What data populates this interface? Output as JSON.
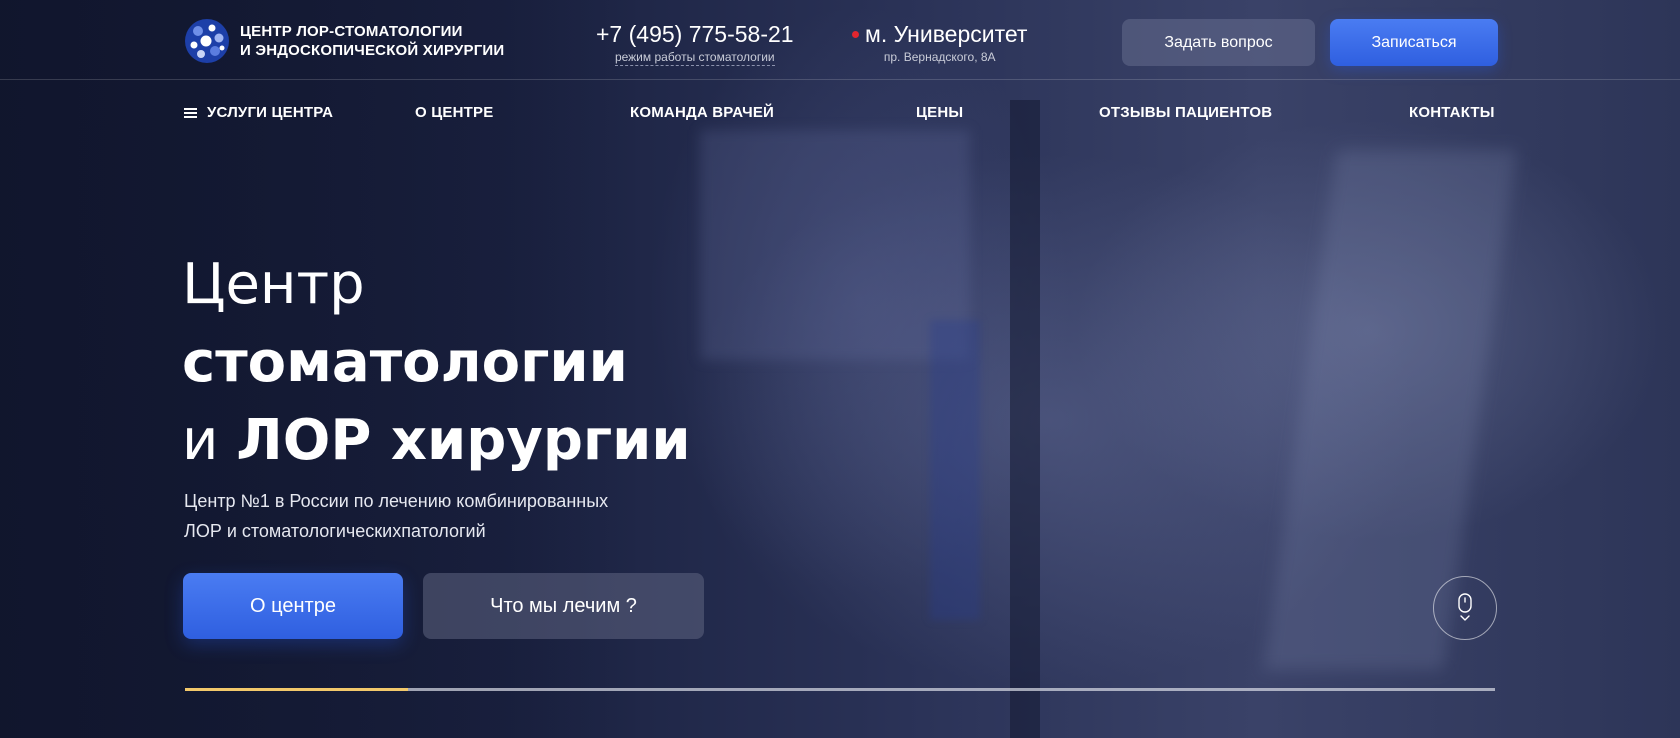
{
  "header": {
    "logo_line1": "Центр ЛОР-стоматологии",
    "logo_line2": "и эндоскопической хирургии",
    "phone": "+7 (495) 775-58-21",
    "phone_sub": "режим работы стоматологии",
    "metro": "м. Университет",
    "address": "пр. Вернадского, 8А",
    "ask_button": "Задать вопрос",
    "signup_button": "Записаться"
  },
  "nav": {
    "items": [
      {
        "label": "Услуги центра",
        "icon": "menu-icon"
      },
      {
        "label": "О центре"
      },
      {
        "label": "Команда врачей"
      },
      {
        "label": "Цены"
      },
      {
        "label": "Отзывы пациентов"
      },
      {
        "label": "Контакты"
      }
    ]
  },
  "hero": {
    "title_line1": "Центр",
    "title_line2": "стоматологии",
    "title_line3_light": "и",
    "title_line3_bold": "ЛОР хирургии",
    "subtitle_line1": "Центр №1 в России по лечению комбинированных",
    "subtitle_line2": "ЛОР и стоматологическихпатологий",
    "about_button": "О центре",
    "treat_button": "Что мы лечим ?",
    "scroll_icon": "mouse-scroll-icon",
    "slider_progress": 0.17
  },
  "colors": {
    "accent_blue": "#3d6ee9",
    "metro_red": "#e2262f",
    "progress_yellow": "#f2c86b"
  }
}
